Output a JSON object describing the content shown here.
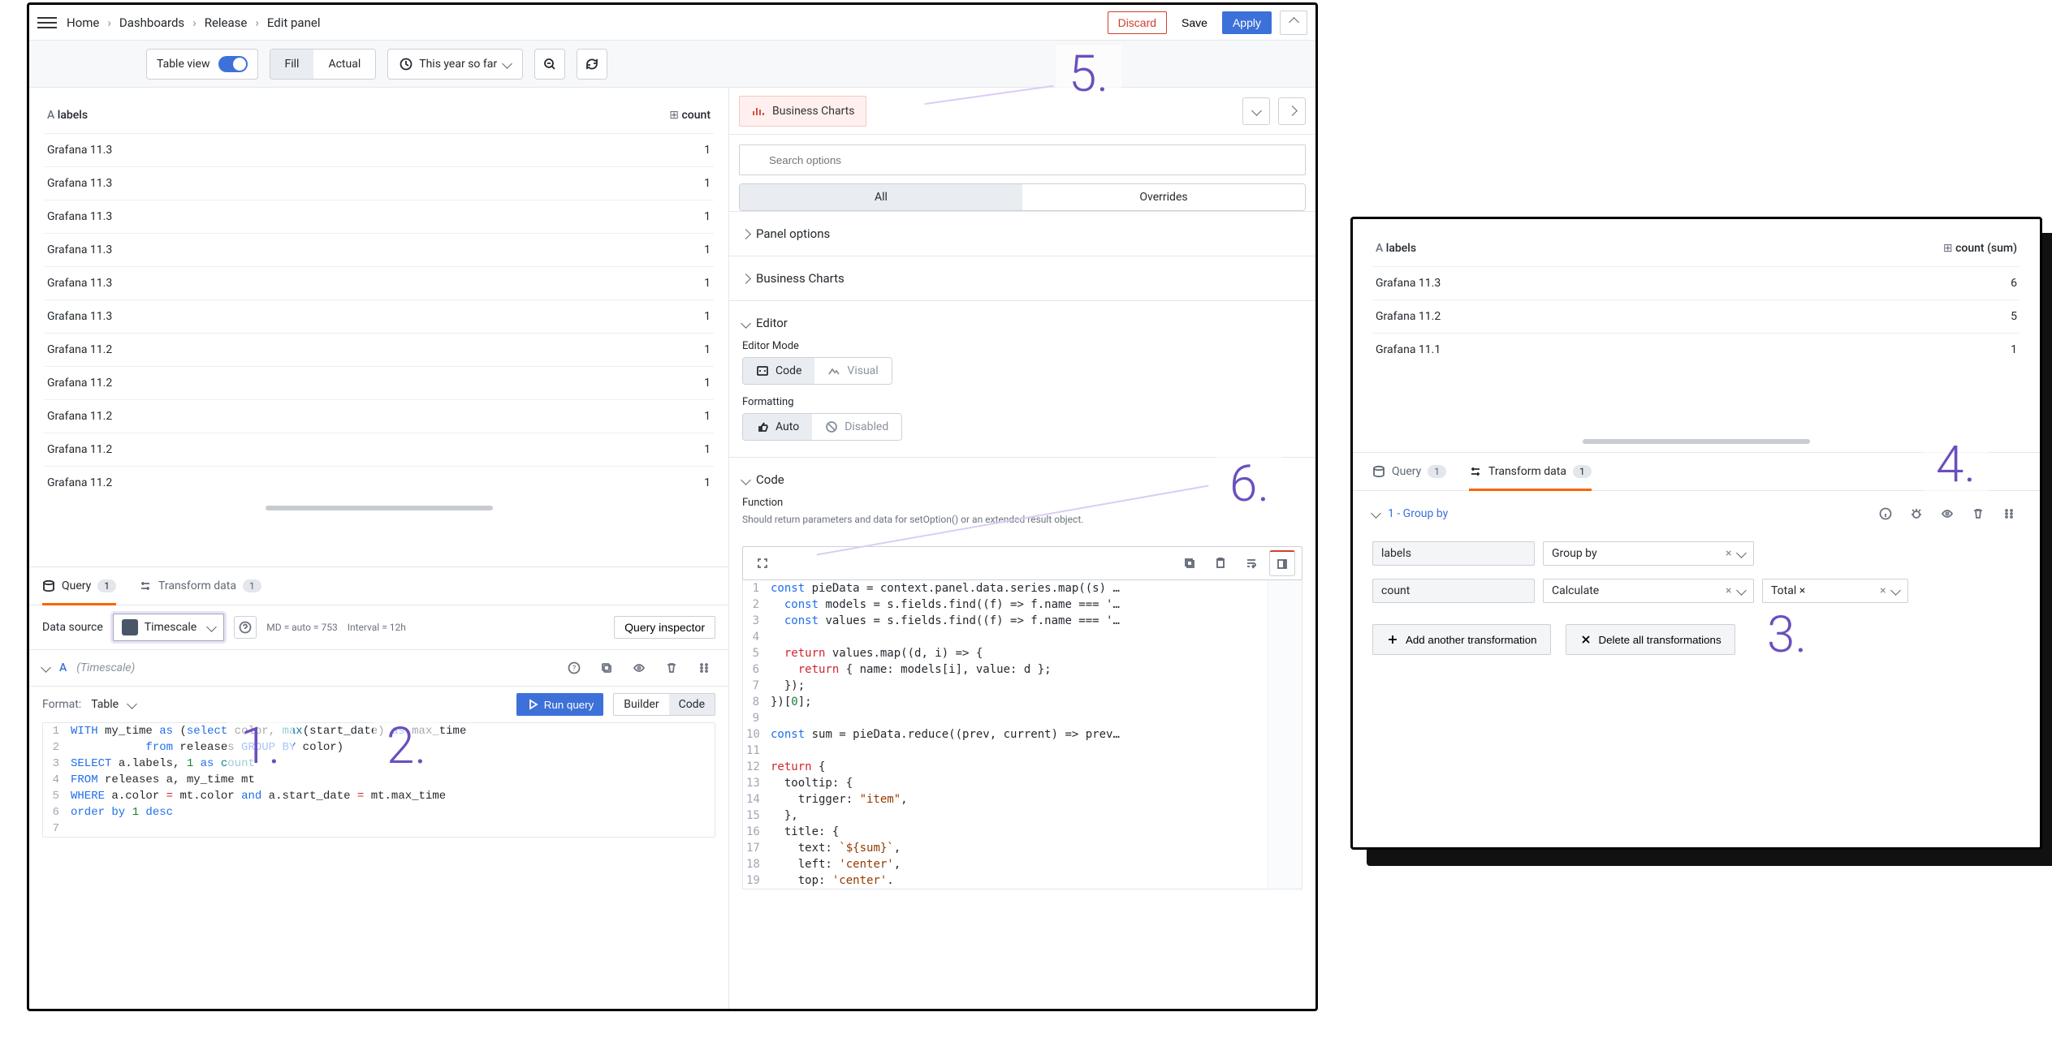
{
  "topbar": {
    "breadcrumbs": [
      "Home",
      "Dashboards",
      "Release",
      "Edit panel"
    ],
    "discard": "Discard",
    "save": "Save",
    "apply": "Apply"
  },
  "toolbar": {
    "table_view": "Table view",
    "fill": "Fill",
    "actual": "Actual",
    "time_label": "This year so far"
  },
  "viz_picker": {
    "label": "Business Charts"
  },
  "table_left": {
    "col_labels": "labels",
    "col_count": "count",
    "rows": [
      {
        "label": "Grafana 11.3",
        "count": 1
      },
      {
        "label": "Grafana 11.3",
        "count": 1
      },
      {
        "label": "Grafana 11.3",
        "count": 1
      },
      {
        "label": "Grafana 11.3",
        "count": 1
      },
      {
        "label": "Grafana 11.3",
        "count": 1
      },
      {
        "label": "Grafana 11.3",
        "count": 1
      },
      {
        "label": "Grafana 11.2",
        "count": 1
      },
      {
        "label": "Grafana 11.2",
        "count": 1
      },
      {
        "label": "Grafana 11.2",
        "count": 1
      },
      {
        "label": "Grafana 11.2",
        "count": 1
      },
      {
        "label": "Grafana 11.2",
        "count": 1
      }
    ]
  },
  "query_tabs": {
    "query": "Query",
    "query_badge": "1",
    "transform": "Transform data",
    "transform_badge": "1"
  },
  "ds_row": {
    "label": "Data source",
    "ds_name": "Timescale",
    "md": "MD = auto = 753",
    "interval": "Interval = 12h",
    "inspector": "Query inspector"
  },
  "query_head": {
    "name": "A",
    "subtitle": "(Timescale)"
  },
  "format_row": {
    "label": "Format:",
    "value": "Table",
    "run": "Run query",
    "builder": "Builder",
    "code": "Code"
  },
  "sql_lines": {
    "l1a": "WITH",
    "l1b": " my_time ",
    "l1c": "as",
    "l1d": " (",
    "l1e": "select",
    "l1f": " color, ",
    "l1g": "max",
    "l1h": "(start_date) ",
    "l1i": "as",
    "l1j": " max_time",
    "l2a": "           ",
    "l2b": "from",
    "l2c": " releases ",
    "l2d": "GROUP BY",
    "l2e": " color)",
    "l3a": "SELECT",
    "l3b": " a.labels, ",
    "l3c": "1",
    "l3d": " as ",
    "l3e": "count",
    "l4a": "FROM",
    "l4b": " releases a, my_time mt",
    "l5a": "WHERE",
    "l5b": " a.color ",
    "l5c": "=",
    "l5d": " mt.color ",
    "l5e": "and",
    "l5f": " a.start_date ",
    "l5g": "=",
    "l5h": " mt.max_time",
    "l6a": "order by ",
    "l6b": "1",
    "l6c": " desc"
  },
  "right_panel": {
    "search_placeholder": "Search options",
    "tab_all": "All",
    "tab_overrides": "Overrides",
    "sec_panel_options": "Panel options",
    "sec_business_charts": "Business Charts",
    "sec_editor": "Editor",
    "editor_mode_label": "Editor Mode",
    "mode_code": "Code",
    "mode_visual": "Visual",
    "formatting_label": "Formatting",
    "fmt_auto": "Auto",
    "fmt_disabled": "Disabled",
    "sec_code": "Code",
    "function_label": "Function",
    "function_desc": "Should return parameters and data for setOption() or an extended result object."
  },
  "js_lines": {
    "l1a": "const",
    "l1b": " pieData = context.panel.data.series.map((s) …",
    "l2a": "  const",
    "l2b": " models = s.fields.find((f) => f.name === '…",
    "l3a": "  const",
    "l3b": " values = s.fields.find((f) => f.name === '…",
    "l5a": "  return",
    "l5b": " values.map((d, i) => {",
    "l6a": "    return",
    "l6b": " { name: models[i], value: d };",
    "l7": "  });",
    "l8a": "})[",
    "l8b": "0",
    "l8c": "];",
    "l10a": "const",
    "l10b": " sum = pieData.reduce((prev, current) => prev…",
    "l12a": "return",
    "l12b": " {",
    "l13": "  tooltip: {",
    "l14a": "    trigger: ",
    "l14b": "\"item\"",
    "l14c": ",",
    "l15": "  },",
    "l16": "  title: {",
    "l17a": "    text: ",
    "l17b": "`${sum}`",
    "l17c": ",",
    "l18a": "    left: ",
    "l18b": "'center'",
    "l18c": ",",
    "l19a": "    top: ",
    "l19b": "'center'",
    "l19c": "."
  },
  "panel2": {
    "col_labels": "labels",
    "col_count": "count (sum)",
    "rows": [
      {
        "label": "Grafana 11.3",
        "count": 6
      },
      {
        "label": "Grafana 11.2",
        "count": 5
      },
      {
        "label": "Grafana 11.1",
        "count": 1
      }
    ],
    "transform_title": "1 - Group by",
    "field_labels": "labels",
    "field_labels_op": "Group by",
    "field_count": "count",
    "field_count_op": "Calculate",
    "field_count_agg": "Total",
    "add_btn": "Add another transformation",
    "delete_btn": "Delete all transformations"
  },
  "callouts": {
    "c1": "1.",
    "c2": "2.",
    "c3": "3.",
    "c4": "4.",
    "c5": "5.",
    "c6": "6."
  }
}
